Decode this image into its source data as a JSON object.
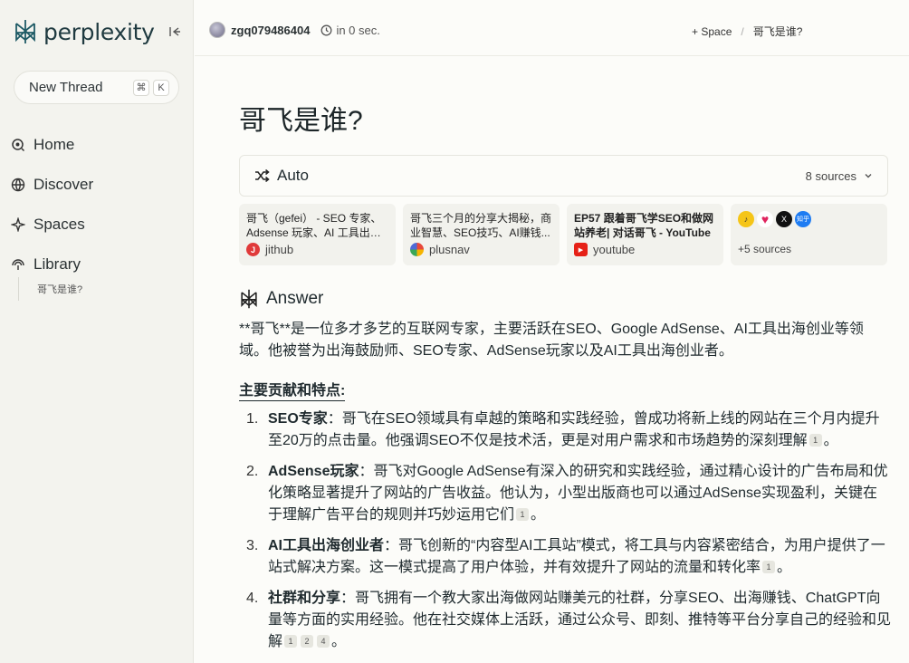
{
  "sidebar": {
    "brand": "perplexity",
    "new_thread": "New Thread",
    "shortcut": [
      "⌘",
      "K"
    ],
    "nav": [
      {
        "label": "Home",
        "icon": "home-icon"
      },
      {
        "label": "Discover",
        "icon": "globe-icon"
      },
      {
        "label": "Spaces",
        "icon": "spaces-icon"
      },
      {
        "label": "Library",
        "icon": "library-icon"
      }
    ],
    "library_items": [
      "哥飞是谁?"
    ]
  },
  "header": {
    "username": "zgq079486404",
    "time": "in 0 sec.",
    "space_label": "+ Space",
    "separator": "/",
    "crumb": "哥飞是谁?"
  },
  "main": {
    "title": "哥飞是谁?",
    "mode": "Auto",
    "sources_count": "8 sources",
    "sources": [
      {
        "title": "哥飞（gefei） - SEO 专家、Adsense 玩家、AI 工具出海创业者",
        "site": "jithub",
        "color": "#e03a3a",
        "glyph": "J"
      },
      {
        "title": "哥飞三个月的分享大揭秘，商业智慧、SEO技巧、AI赚钱...",
        "site": "plusnav",
        "color": "#4f6ad6",
        "glyph": "✿"
      },
      {
        "title": "EP57 跟着哥飞学SEO和做网站养老| 对话哥飞 - YouTube",
        "site": "youtube",
        "color": "#e62117",
        "glyph": "▶"
      }
    ],
    "more_sources": "+5 sources",
    "more_icon_colors": [
      "#f5c518",
      "#e0245e",
      "#111111",
      "#1e7cf2"
    ],
    "more_icon_glyphs": [
      "♪",
      "♥",
      "X",
      "知乎"
    ],
    "answer_label": "Answer",
    "intro": "**哥飞**是一位多才多艺的互联网专家，主要活跃在SEO、Google AdSense、AI工具出海创业等领域。他被誉为出海鼓励师、SEO专家、AdSense玩家以及AI工具出海创业者。",
    "section_title": "主要贡献和特点:",
    "items": [
      {
        "num": "1.",
        "bold": "SEO专家",
        "text": "：哥飞在SEO领域具有卓越的策略和实践经验，曾成功将新上线的网站在三个月内提升至20万的点击量。他强调SEO不仅是技术活，更是对用户需求和市场趋势的深刻理解",
        "cites": [
          "1"
        ]
      },
      {
        "num": "2.",
        "bold": "AdSense玩家",
        "text": "：哥飞对Google AdSense有深入的研究和实践经验，通过精心设计的广告布局和优化策略显著提升了网站的广告收益。他认为，小型出版商也可以通过AdSense实现盈利，关键在于理解广告平台的规则并巧妙运用它们",
        "cites": [
          "1"
        ]
      },
      {
        "num": "3.",
        "bold": "AI工具出海创业者",
        "text": "：哥飞创新的“内容型AI工具站”模式，将工具与内容紧密结合，为用户提供了一站式解决方案。这一模式提高了用户体验，并有效提升了网站的流量和转化率",
        "cites": [
          "1"
        ]
      },
      {
        "num": "4.",
        "bold": "社群和分享",
        "text": "：哥飞拥有一个教大家出海做网站赚美元的社群，分享SEO、出海赚钱、ChatGPT向量等方面的实用经验。他在社交媒体上活跃，通过公众号、即刻、推特等平台分享自己的经验和见解",
        "cites": [
          "1",
          "2",
          "4"
        ]
      }
    ],
    "period": "。"
  }
}
